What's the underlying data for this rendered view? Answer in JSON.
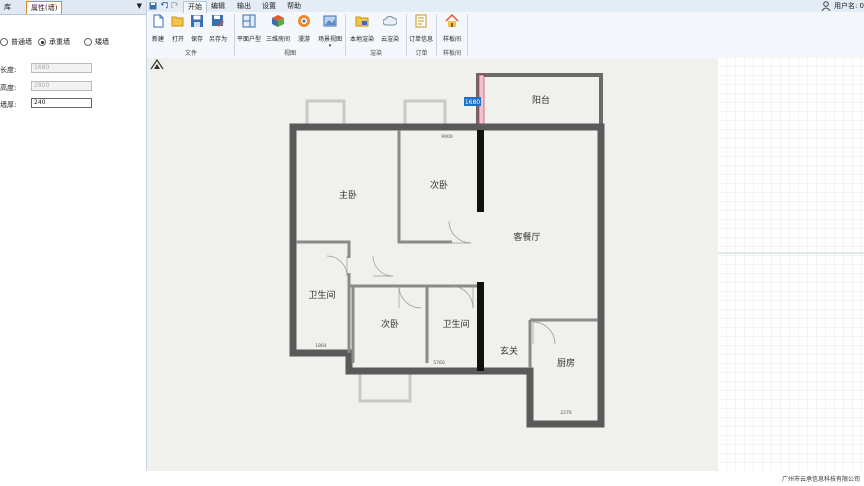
{
  "left_panel": {
    "tabs": [
      "库",
      "属性(墙)"
    ],
    "wall_types": [
      {
        "label": "普通墙",
        "checked": false
      },
      {
        "label": "承重墙",
        "checked": true
      },
      {
        "label": "矮墙",
        "checked": false
      }
    ],
    "properties": [
      {
        "label": "长度:",
        "value": "1680"
      },
      {
        "label": "高度:",
        "value": "2800"
      },
      {
        "label": "墙厚:",
        "value": "240"
      }
    ]
  },
  "ribbon": {
    "tabs": [
      "开始",
      "编辑",
      "输出",
      "设置",
      "帮助"
    ],
    "active_tab": "开始",
    "user_label": "用户名: 0",
    "buttons": [
      {
        "label": "新建",
        "icon": "new-file-icon"
      },
      {
        "label": "打开",
        "icon": "folder-open-icon"
      },
      {
        "label": "保存",
        "icon": "save-icon"
      },
      {
        "label": "另存为",
        "icon": "save-as-icon"
      },
      {
        "label": "平面户型",
        "icon": "floor-plan-icon"
      },
      {
        "label": "三维房间",
        "icon": "cube-3d-icon"
      },
      {
        "label": "漫游",
        "icon": "walkthrough-icon"
      },
      {
        "label": "场景视图",
        "icon": "scene-view-icon"
      },
      {
        "label": "本地渲染",
        "icon": "local-render-icon"
      },
      {
        "label": "云渲染",
        "icon": "cloud-render-icon"
      },
      {
        "label": "订单信息",
        "icon": "order-info-icon"
      },
      {
        "label": "样板间",
        "icon": "model-room-icon"
      }
    ],
    "groups": [
      "文件",
      "视图",
      "渲染",
      "订单",
      "样板间"
    ]
  },
  "floorplan": {
    "rooms": [
      "阳台",
      "主卧",
      "次卧",
      "客餐厅",
      "卫生间",
      "次卧",
      "卫生间",
      "玄关",
      "厨房"
    ],
    "dimensions": [
      "9900",
      "1864",
      "5760",
      "2276"
    ],
    "selected_wall_length": "1680"
  },
  "footer": {
    "company": "广州市云承信息科技有限公司"
  },
  "colors": {
    "tab_highlight": "#d98a2b",
    "wall": "#5a5a5a",
    "selected_wall": "#cc2244",
    "canvas_bg": "#f0f0ec"
  }
}
